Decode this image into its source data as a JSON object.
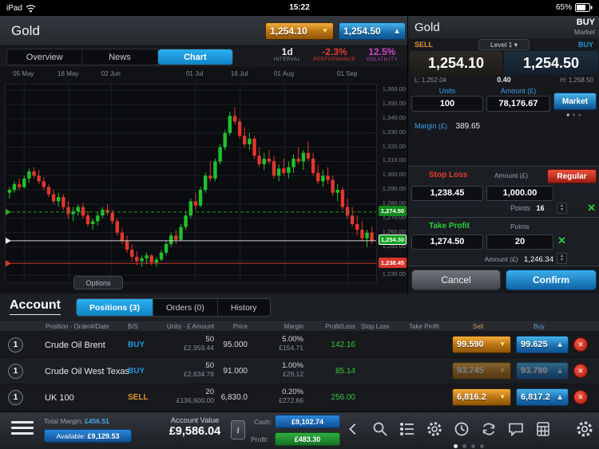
{
  "status_bar": {
    "carrier": "iPad",
    "time": "15:22",
    "battery": "65%"
  },
  "icons": {
    "down_arrow": "▼",
    "up_arrow": "▲",
    "dropdown_arrow": "▾",
    "close": "✕",
    "remove": "✕",
    "stepper_up": "▲",
    "stepper_down": "▼",
    "info": "i"
  },
  "header": {
    "title": "Gold",
    "sell_button": "1,254.10",
    "buy_button": "1,254.50"
  },
  "tabs": {
    "overview": "Overview",
    "news": "News",
    "chart": "Chart"
  },
  "chart_meta": {
    "interval_value": "1d",
    "interval_label": "INTERVAL",
    "performance_value": "-2.3%",
    "performance_label": "PERFORMANCE",
    "volatility_value": "12.5%",
    "volatility_label": "VOLATILITY"
  },
  "options_button": "Options",
  "chart_data": {
    "type": "candlestick",
    "title": "Gold daily candlestick chart",
    "ylim": [
      1364,
      1224
    ],
    "up_color": "#1fc32a",
    "down_color": "#e2382c",
    "grid_color": "#1c2026",
    "y_ticks": [
      {
        "value": 1360,
        "label": "1,360.00"
      },
      {
        "value": 1350,
        "label": "1,350.00"
      },
      {
        "value": 1340,
        "label": "1,340.00"
      },
      {
        "value": 1330,
        "label": "1,330.00"
      },
      {
        "value": 1320,
        "label": "1,320.00"
      },
      {
        "value": 1310,
        "label": "1,310.00"
      },
      {
        "value": 1300,
        "label": "1,300.00"
      },
      {
        "value": 1290,
        "label": "1,290.00"
      },
      {
        "value": 1280,
        "label": "1,280.00"
      },
      {
        "value": 1270,
        "label": "1,270.00"
      },
      {
        "value": 1260,
        "label": "1,260.00"
      },
      {
        "value": 1250,
        "label": "1,250.00"
      },
      {
        "value": 1240,
        "label": "1,240.00"
      },
      {
        "value": 1230,
        "label": "1,230.00"
      }
    ],
    "x_ticks": [
      {
        "label": "05 May",
        "pos": 0.05
      },
      {
        "label": "16 May",
        "pos": 0.17
      },
      {
        "label": "02 Jun",
        "pos": 0.285
      },
      {
        "label": "01 Jul",
        "pos": 0.51
      },
      {
        "label": "16 Jul",
        "pos": 0.63
      },
      {
        "label": "01 Aug",
        "pos": 0.75
      },
      {
        "label": "01 Sep",
        "pos": 0.92
      }
    ],
    "markers": [
      {
        "price": 1274.5,
        "label": "1,274.50",
        "line_color": "#2aa32f",
        "tag": "tag-green",
        "style": "dashed"
      },
      {
        "price": 1254.3,
        "label": "1,254.30",
        "line_color": "#e8e8e8",
        "tag": "tag-current",
        "style": "solid"
      },
      {
        "price": 1238.45,
        "label": "1,238.45",
        "line_color": "#e0362a",
        "tag": "tag-red",
        "style": "solid"
      }
    ],
    "candles": [
      [
        1288,
        1292,
        1284,
        1290
      ],
      [
        1290,
        1296,
        1288,
        1294
      ],
      [
        1294,
        1298,
        1290,
        1292
      ],
      [
        1292,
        1300,
        1291,
        1298
      ],
      [
        1298,
        1305,
        1295,
        1303
      ],
      [
        1303,
        1306,
        1298,
        1300
      ],
      [
        1300,
        1304,
        1294,
        1296
      ],
      [
        1296,
        1299,
        1290,
        1292
      ],
      [
        1292,
        1294,
        1285,
        1287
      ],
      [
        1287,
        1290,
        1280,
        1282
      ],
      [
        1282,
        1288,
        1278,
        1285
      ],
      [
        1285,
        1287,
        1276,
        1278
      ],
      [
        1278,
        1282,
        1270,
        1273
      ],
      [
        1273,
        1278,
        1268,
        1275
      ],
      [
        1275,
        1280,
        1272,
        1278
      ],
      [
        1278,
        1281,
        1270,
        1272
      ],
      [
        1272,
        1275,
        1264,
        1266
      ],
      [
        1266,
        1270,
        1262,
        1268
      ],
      [
        1268,
        1274,
        1265,
        1272
      ],
      [
        1272,
        1278,
        1270,
        1276
      ],
      [
        1276,
        1280,
        1272,
        1274
      ],
      [
        1274,
        1276,
        1266,
        1268
      ],
      [
        1268,
        1270,
        1258,
        1260
      ],
      [
        1260,
        1263,
        1252,
        1254
      ],
      [
        1254,
        1258,
        1246,
        1248
      ],
      [
        1248,
        1252,
        1240,
        1243
      ],
      [
        1243,
        1247,
        1237,
        1240
      ],
      [
        1240,
        1244,
        1236,
        1242
      ],
      [
        1242,
        1246,
        1238,
        1244
      ],
      [
        1244,
        1245,
        1237,
        1239
      ],
      [
        1239,
        1243,
        1236,
        1241
      ],
      [
        1241,
        1248,
        1240,
        1246
      ],
      [
        1246,
        1254,
        1244,
        1252
      ],
      [
        1252,
        1260,
        1250,
        1258
      ],
      [
        1258,
        1262,
        1252,
        1255
      ],
      [
        1255,
        1266,
        1254,
        1264
      ],
      [
        1264,
        1275,
        1262,
        1272
      ],
      [
        1272,
        1284,
        1270,
        1282
      ],
      [
        1282,
        1288,
        1276,
        1279
      ],
      [
        1279,
        1292,
        1278,
        1290
      ],
      [
        1290,
        1302,
        1288,
        1300
      ],
      [
        1300,
        1310,
        1296,
        1298
      ],
      [
        1298,
        1312,
        1296,
        1310
      ],
      [
        1310,
        1322,
        1308,
        1320
      ],
      [
        1320,
        1332,
        1318,
        1330
      ],
      [
        1330,
        1345,
        1328,
        1342
      ],
      [
        1342,
        1348,
        1336,
        1338
      ],
      [
        1338,
        1340,
        1326,
        1328
      ],
      [
        1328,
        1334,
        1320,
        1322
      ],
      [
        1322,
        1330,
        1318,
        1326
      ],
      [
        1326,
        1328,
        1312,
        1314
      ],
      [
        1314,
        1320,
        1306,
        1308
      ],
      [
        1308,
        1316,
        1304,
        1312
      ],
      [
        1312,
        1318,
        1308,
        1310
      ],
      [
        1310,
        1314,
        1298,
        1300
      ],
      [
        1300,
        1308,
        1296,
        1305
      ],
      [
        1305,
        1312,
        1300,
        1302
      ],
      [
        1302,
        1310,
        1298,
        1306
      ],
      [
        1306,
        1315,
        1302,
        1312
      ],
      [
        1312,
        1320,
        1308,
        1310
      ],
      [
        1310,
        1318,
        1304,
        1316
      ],
      [
        1316,
        1324,
        1310,
        1312
      ],
      [
        1312,
        1316,
        1300,
        1302
      ],
      [
        1302,
        1308,
        1294,
        1296
      ],
      [
        1296,
        1304,
        1292,
        1300
      ],
      [
        1300,
        1306,
        1294,
        1297
      ],
      [
        1297,
        1300,
        1286,
        1288
      ],
      [
        1288,
        1294,
        1282,
        1290
      ],
      [
        1290,
        1292,
        1276,
        1278
      ],
      [
        1278,
        1284,
        1270,
        1272
      ],
      [
        1272,
        1278,
        1264,
        1266
      ],
      [
        1266,
        1272,
        1258,
        1262
      ],
      [
        1262,
        1268,
        1254,
        1256
      ],
      [
        1256,
        1262,
        1250,
        1260
      ],
      [
        1260,
        1264,
        1252,
        1254.3
      ]
    ]
  },
  "ticket": {
    "title": "Gold",
    "mode_buy": "BUY",
    "mode_market": "Market",
    "sell_label": "SELL",
    "buy_label": "BUY",
    "level_button": "Level 1",
    "sell_price": "1,254.10",
    "buy_price": "1,254.50",
    "low": "L: 1,252.04",
    "spread": "0.40",
    "high": "H: 1,258.50",
    "units_label": "Units",
    "units_value": "100",
    "amount_label": "Amount (£)",
    "amount_value": "78,176.67",
    "market_button": "Market",
    "margin_label": "Margin (£)",
    "margin_value": "389.65",
    "stop_loss": {
      "title": "Stop Loss",
      "amount_label": "Amount (£)",
      "type_button": "Regular",
      "price": "1,238.45",
      "amount": "1,000.00",
      "points_label": "Points",
      "points_value": "16"
    },
    "take_profit": {
      "title": "Take Profit",
      "points_label": "Points",
      "price": "1,274.50",
      "points": "20",
      "amount_label": "Amount (£)",
      "amount_value": "1,246.34"
    },
    "cancel_button": "Cancel",
    "confirm_button": "Confirm"
  },
  "account": {
    "title": "Account",
    "tabs": [
      {
        "label": "Positions (3)"
      },
      {
        "label": "Orders (0)"
      },
      {
        "label": "History"
      }
    ],
    "columns": [
      "Position - Order#/Date",
      "B/S",
      "Units - £ Amount",
      "Price",
      "Margin",
      "Profit/Loss",
      "Stop Loss",
      "Take Profit",
      "Sell",
      "Buy"
    ],
    "rows": [
      {
        "num": "1",
        "name": "Crude Oil Brent",
        "side": "BUY",
        "units": "50",
        "amount": "£2,959.44",
        "price": "95.000",
        "margin_pct": "5.00%",
        "margin_amt": "£154.71",
        "pl": "142.16",
        "sell": "99.590",
        "buy": "99.625"
      },
      {
        "num": "1",
        "name": "Crude Oil West Texas",
        "side": "BUY",
        "units": "50",
        "amount": "£2,834.78",
        "price": "91.000",
        "margin_pct": "1.00%",
        "margin_amt": "£29.12",
        "pl": "85.14",
        "sell": "93.745",
        "buy": "93.780"
      },
      {
        "num": "1",
        "name": "UK 100",
        "side": "SELL",
        "units": "20",
        "amount": "£136,600.00",
        "price": "6,830.0",
        "margin_pct": "0.20%",
        "margin_amt": "£272.66",
        "pl": "256.00",
        "sell": "6,816.2",
        "buy": "6,817.2"
      }
    ]
  },
  "footer": {
    "total_margin_label": "Total Margin:",
    "total_margin_value": "£456.51",
    "available_label": "Available:",
    "available_value": "£9,129.53",
    "account_value_label": "Account Value",
    "account_value": "£9,586.04",
    "cash_label": "Cash:",
    "cash_value": "£9,102.74",
    "profit_label": "Profit:",
    "profit_value": "£483.30"
  }
}
